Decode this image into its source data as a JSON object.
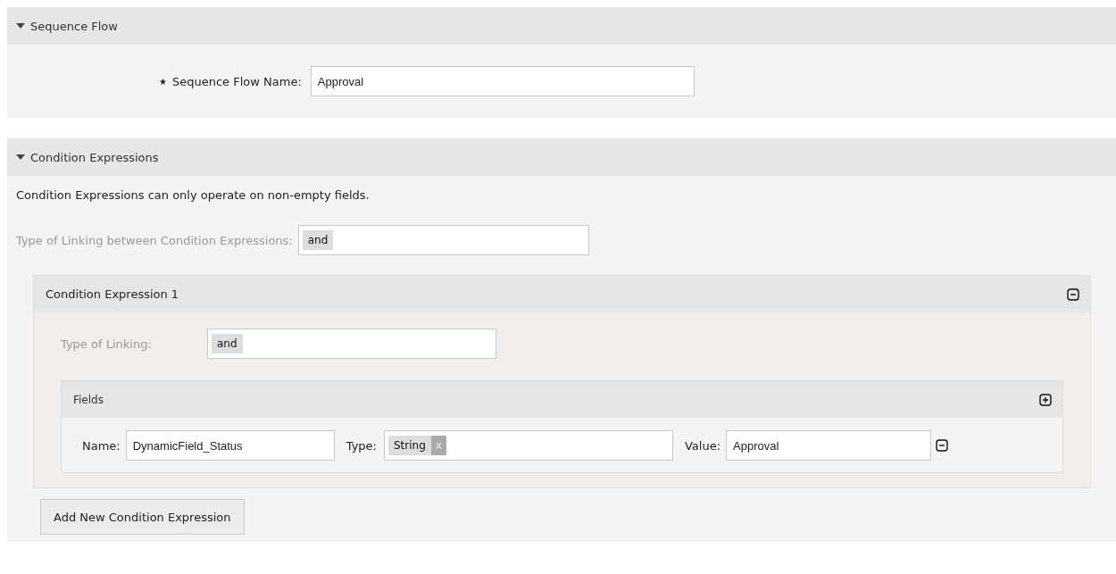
{
  "sections": [
    {
      "title": "Sequence Flow",
      "expanded": true,
      "kind": "name",
      "required_mark": "★",
      "label": "Sequence Flow Name:",
      "value": "Approval"
    },
    {
      "title": "Condition Expressions",
      "expanded": true,
      "kind": "conditions",
      "note": "Condition Expressions can only operate on non-empty fields.",
      "linking_label": "Type of Linking between Condition Expressions:",
      "linking_value": "and",
      "expressions": [
        {
          "title": "Condition Expression 1",
          "linking_label": "Type of Linking:",
          "linking_value": "and",
          "fields_title": "Fields",
          "fields": [
            {
              "name_label": "Name:",
              "name": "DynamicField_Status",
              "type_label": "Type:",
              "type": "String",
              "type_remove": "x",
              "value_label": "Value:",
              "value": "Approval"
            }
          ]
        }
      ],
      "add_button": "Add New Condition Expression"
    }
  ]
}
